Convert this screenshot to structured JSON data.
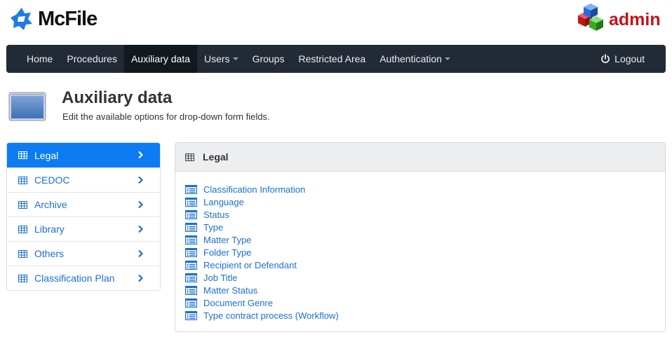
{
  "brand": {
    "name": "McFile",
    "admin_label": "admin"
  },
  "navbar": {
    "items": [
      {
        "label": "Home",
        "active": false,
        "dropdown": false
      },
      {
        "label": "Procedures",
        "active": false,
        "dropdown": false
      },
      {
        "label": "Auxiliary data",
        "active": true,
        "dropdown": false
      },
      {
        "label": "Users",
        "active": false,
        "dropdown": true
      },
      {
        "label": "Groups",
        "active": false,
        "dropdown": false
      },
      {
        "label": "Restricted Area",
        "active": false,
        "dropdown": false
      },
      {
        "label": "Authentication",
        "active": false,
        "dropdown": true
      }
    ],
    "logout_label": "Logout"
  },
  "page": {
    "title": "Auxiliary data",
    "subtitle": "Edit the available options for drop-down form fields."
  },
  "sidebar": {
    "items": [
      {
        "label": "Legal",
        "active": true
      },
      {
        "label": "CEDOC",
        "active": false
      },
      {
        "label": "Archive",
        "active": false
      },
      {
        "label": "Library",
        "active": false
      },
      {
        "label": "Others",
        "active": false
      },
      {
        "label": "Classification Plan",
        "active": false
      }
    ]
  },
  "panel": {
    "title": "Legal",
    "items": [
      "Classification Information",
      "Language",
      "Status",
      "Type",
      "Matter Type",
      "Folder Type",
      "Recipient or Defendant",
      "Job Title",
      "Matter Status",
      "Document Genre",
      "Type contract process (Workflow)"
    ]
  },
  "colors": {
    "navbar_bg": "#222a36",
    "navbar_active_bg": "#121820",
    "accent": "#0d7bf2",
    "link": "#1a6fd3",
    "brand_logo": "#1e7be6",
    "admin_red": "#c0141c"
  }
}
